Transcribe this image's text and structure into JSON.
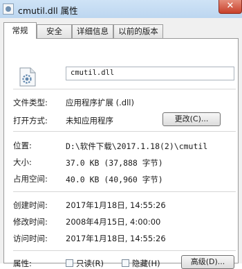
{
  "window": {
    "title": "cmutil.dll 属性",
    "close_glyph": "✕"
  },
  "tabs": [
    {
      "label": "常规"
    },
    {
      "label": "安全"
    },
    {
      "label": "详细信息"
    },
    {
      "label": "以前的版本"
    }
  ],
  "general": {
    "file_icon": "dll-gear-file-icon",
    "file_name": "cmutil.dll",
    "file_type_label": "文件类型:",
    "file_type_value": "应用程序扩展 (.dll)",
    "opens_with_label": "打开方式:",
    "opens_with_value": "未知应用程序",
    "change_button": "更改(C)...",
    "location_label": "位置:",
    "location_value": "D:\\软件下载\\2017.1.18(2)\\cmutil",
    "size_label": "大小:",
    "size_value": "37.0 KB (37,888 字节)",
    "size_on_disk_label": "占用空间:",
    "size_on_disk_value": "40.0 KB (40,960 字节)",
    "created_label": "创建时间:",
    "created_value": "2017年1月18日, 14:55:26",
    "modified_label": "修改时间:",
    "modified_value": "2008年4月15日, 4:00:00",
    "accessed_label": "访问时间:",
    "accessed_value": "2017年1月18日, 14:55:26",
    "attributes_label": "属性:",
    "readonly_label": "只读(R)",
    "readonly_checked": false,
    "hidden_label": "隐藏(H)",
    "hidden_checked": false,
    "advanced_button": "高级(D)..."
  }
}
